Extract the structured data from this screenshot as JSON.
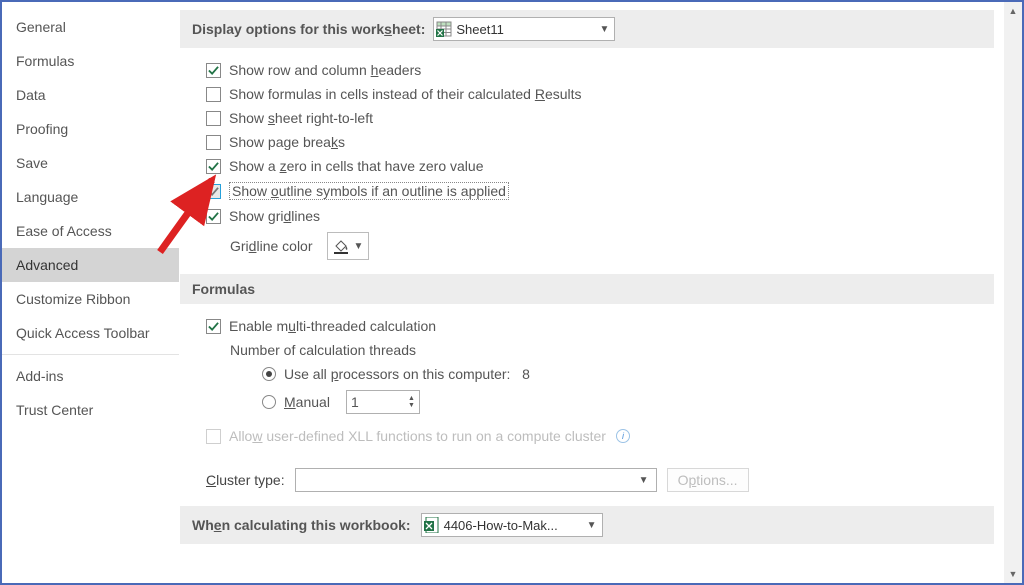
{
  "sidebar": {
    "items": [
      {
        "label": "General"
      },
      {
        "label": "Formulas"
      },
      {
        "label": "Data"
      },
      {
        "label": "Proofing"
      },
      {
        "label": "Save"
      },
      {
        "label": "Language"
      },
      {
        "label": "Ease of Access"
      },
      {
        "label": "Advanced"
      },
      {
        "label": "Customize Ribbon"
      },
      {
        "label": "Quick Access Toolbar"
      },
      {
        "label": "Add-ins"
      },
      {
        "label": "Trust Center"
      }
    ],
    "selected_index": 7
  },
  "display_options": {
    "header_prefix": "Display options for this work",
    "header_accel": "s",
    "header_suffix": "heet:",
    "sheet_name": "Sheet11",
    "items": [
      {
        "checked": true,
        "label": "Show row and column headers",
        "accel": "h",
        "before": "Show row and column ",
        "after": "eaders"
      },
      {
        "checked": false,
        "label": "Show formulas in cells instead of their calculated results",
        "accel": "R",
        "before": "Show formulas in cells instead of their calculated ",
        "after": "esults"
      },
      {
        "checked": false,
        "label": "Show sheet right-to-left",
        "accel": "s",
        "before": "Show ",
        "after": "heet right-to-left"
      },
      {
        "checked": false,
        "label": "Show page breaks",
        "accel": "K",
        "before": "Show page brea",
        "after": "s"
      },
      {
        "checked": true,
        "label": "Show a zero in cells that have zero value",
        "accel": "z",
        "before": "Show a ",
        "after": "ero in cells that have zero value"
      },
      {
        "checked": true,
        "label": "Show outline symbols if an outline is applied",
        "accel": "o",
        "before": "Show ",
        "after": "utline symbols if an outline is applied",
        "highlighted": true
      },
      {
        "checked": true,
        "label": "Show gridlines",
        "accel": "d",
        "before": "Show gri",
        "after": "lines"
      }
    ],
    "gridline_color_label_before": "Gri",
    "gridline_color_label_accel": "d",
    "gridline_color_label_after": "line color"
  },
  "formulas": {
    "header": "Formulas",
    "enable_mt": {
      "checked": true,
      "before": "Enable m",
      "accel": "u",
      "after": "lti-threaded calculation"
    },
    "threads_label": "Number of calculation threads",
    "use_all": {
      "checked": true,
      "before": "Use all ",
      "accel": "p",
      "after": "rocessors on this computer:",
      "count": "8"
    },
    "manual": {
      "checked": false,
      "accel": "M",
      "after": "anual",
      "value": "1"
    },
    "allow_xll": {
      "disabled": true,
      "before": "Allow user-defined XLL functions to run on a compute cluster",
      "accel": "W"
    },
    "cluster_before": "",
    "cluster_accel": "C",
    "cluster_after": "luster type:",
    "options_btn_before": "O",
    "options_btn_accel": "p",
    "options_btn_after": "tions..."
  },
  "workbook": {
    "header_before": "Wh",
    "header_accel": "e",
    "header_after": "n calculating this workbook:",
    "name": "4406-How-to-Mak..."
  }
}
